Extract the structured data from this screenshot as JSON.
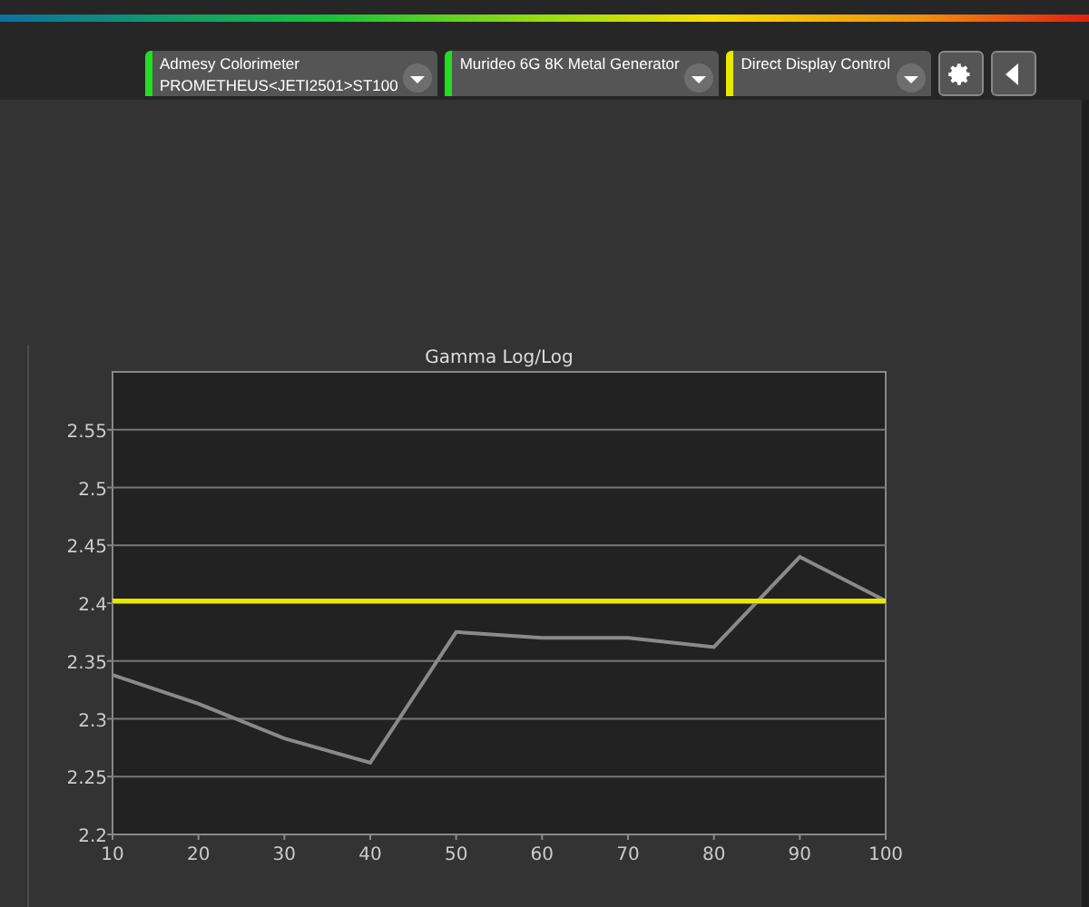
{
  "devices": [
    {
      "name": "Admesy Colorimeter",
      "detail": "PROMETHEUS<JETI2501>ST100",
      "color": "#22dd22"
    },
    {
      "name": "Murideo 6G 8K Metal Generator",
      "color": "#22dd22"
    },
    {
      "name": "Direct Display Control",
      "color": "#e8e800"
    }
  ],
  "chart": {
    "chart_data": {
      "type": "line",
      "title": "Gamma Log/Log",
      "x": [
        10,
        20,
        30,
        40,
        50,
        60,
        70,
        80,
        90,
        100
      ],
      "xlim": [
        10,
        100
      ],
      "ylim": [
        2.2,
        2.6
      ],
      "xticks": [
        10,
        20,
        30,
        40,
        50,
        60,
        70,
        80,
        90,
        100
      ],
      "yticks": [
        2.2,
        2.25,
        2.3,
        2.35,
        2.4,
        2.45,
        2.5,
        2.55
      ],
      "grid": true,
      "series": [
        {
          "color": "#8a8a8a",
          "values": [
            2.338,
            2.313,
            2.283,
            2.262,
            2.375,
            2.37,
            2.37,
            2.362,
            2.44,
            2.402
          ]
        },
        {
          "color": "#e8e800",
          "values": [
            2.402,
            2.402,
            2.402,
            2.402,
            2.402,
            2.402,
            2.402,
            2.402,
            2.402,
            2.402
          ]
        }
      ]
    }
  }
}
